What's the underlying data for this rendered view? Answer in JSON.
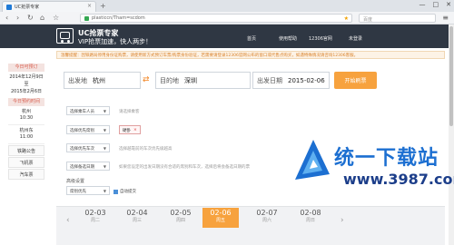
{
  "browser": {
    "tab_title": "UC抢票专家",
    "url": "plasticcn/Tham=scdom",
    "search_placeholder": "百度",
    "window_controls": [
      "—",
      "□",
      "✕"
    ]
  },
  "app": {
    "brand_name": "UC抢票专家",
    "slogan": "VIP抢票加速，快人两步！",
    "nav": [
      "首页",
      "使用帮助",
      "12306官网",
      "未登录"
    ]
  },
  "notice": "温馨提醒：因铁路局停用身份证购票，请使用新方式预订车票/购票身份验证，若需要请登录12306官网公布的窗口或代售点购买，如遇特殊情况请咨询12306客服。",
  "sidebar": {
    "header": "今日可预订",
    "booking_date_lines": [
      "2014年12月9日",
      "至",
      "2015年2月6日"
    ],
    "list_header": "今日预约时间",
    "times": [
      {
        "city": "杭州",
        "time": "10:30"
      },
      {
        "city": "杭州东",
        "time": "11:00"
      }
    ],
    "categories": [
      "铁路公告",
      "飞机票",
      "汽车票"
    ]
  },
  "form": {
    "from_label": "出发地",
    "from_value": "杭州",
    "to_label": "目的地",
    "to_value": "深圳",
    "date_label": "出发日期",
    "date_value": "2015-02-06",
    "query_button": "开始刷票",
    "options": [
      {
        "select": "选择乘车人员",
        "hint": "请选择乘客"
      },
      {
        "select": "选择优先席别",
        "hint": ""
      },
      {
        "select": "选择优先车次",
        "hint": "选择越靠前的车次优先级越高"
      },
      {
        "select": "选择备选日期",
        "hint": "如果您设定的出发日期没有合适的席别和车次，选择后将会备选日期的票"
      }
    ],
    "seat_chip": "硬卧",
    "advanced_label": "高级设置",
    "priority_select": "席别优先",
    "auto_submit": "自动提交"
  },
  "dates": [
    {
      "date": "02-03",
      "weekday": "周二",
      "active": false
    },
    {
      "date": "02-04",
      "weekday": "周三",
      "active": false
    },
    {
      "date": "02-05",
      "weekday": "周四",
      "active": false
    },
    {
      "date": "02-06",
      "weekday": "周五",
      "active": true
    },
    {
      "date": "02-07",
      "weekday": "周六",
      "active": false
    },
    {
      "date": "02-08",
      "weekday": "周日",
      "active": false
    }
  ],
  "watermark": {
    "title": "统一下载站",
    "url": "www.3987.com"
  },
  "colors": {
    "header_bg": "#2f3743",
    "accent_orange": "#f7a23e",
    "watermark_blue": "#1c6fd1"
  }
}
